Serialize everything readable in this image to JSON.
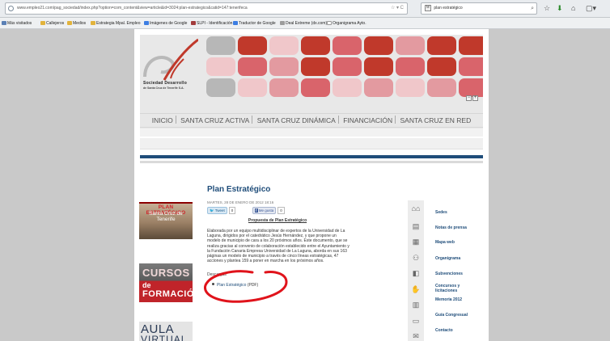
{
  "browser": {
    "url": "www.empleo21.com/pag_sociedad/index.php?option=com_content&view=article&id=3024:plan-estrategico&catid=147:tenerifeca",
    "search_query": "plan estratégico",
    "search_engine_glyph": "W",
    "bookmarks": [
      {
        "label": "Más visitados",
        "icon_color": "#5a7fb5"
      },
      {
        "label": "Callejeros",
        "icon_color": "#e2b33c"
      },
      {
        "label": "Medios",
        "icon_color": "#e2b33c"
      },
      {
        "label": "Estrategia Mpal. Empleo",
        "icon_color": "#e2b33c"
      },
      {
        "label": "Imágenes de Google",
        "icon_color": "#3c7de2"
      },
      {
        "label": "SLPI - Identificación",
        "icon_color": "#a23c3c"
      },
      {
        "label": "Traductor de Google",
        "icon_color": "#3c7de2"
      },
      {
        "label": "Deal Extreme (dx.com)",
        "icon_color": "#9c9c9c"
      },
      {
        "label": "Organigrama Ayto.",
        "icon_color": "#e2e2e2"
      }
    ]
  },
  "header": {
    "logo_line1": "Sociedad Desarrollo",
    "logo_line2": "de Santa Cruz de Tenerife S.A.",
    "square_colors": [
      "#c0392b",
      "#c0392b",
      "#c0392b",
      "#c0392b",
      "#c0392b",
      "#c0392b",
      "#c0392b",
      "#c0392b",
      "#c0392b",
      "#c0392b"
    ],
    "font_minus": "−",
    "font_plus": "+"
  },
  "nav": {
    "items": [
      "INICIO",
      "SANTA CRUZ ACTIVA",
      "SANTA CRUZ DINÁMICA",
      "FINANCIACIÓN",
      "SANTA CRUZ EN RED"
    ]
  },
  "banners": {
    "plan_title": "PLAN ESTRATÉGICO",
    "plan_sub1": "Santa Cruz de",
    "plan_sub2": "Tenerife",
    "cursos_line1": "CURSOS",
    "cursos_line2": "de",
    "cursos_line3": "FORMACIÓN",
    "aula_line1": "AULA",
    "aula_line2": "VIRTUAL"
  },
  "article": {
    "title": "Plan Estratégico",
    "date": "MARTES, 28 DE ENERO DE 2012 18:16",
    "tweet_label": "Tweet",
    "tweet_count": "0",
    "like_label": "Me gusta",
    "like_count": "0",
    "proposal_heading": "Propuesta de Plan Estratégico",
    "body": "Elaborada por un equipo multidisciplinar de expertos de la Universidad de La Laguna, dirigidos por el catedrático Jesús Hernández, y que propone un modelo de municipio de cara a los 20 próximos años. Este documento, que se realiza gracias al convenio de colaboración establecido entre el Ayuntamiento y la Fundación Canaria Empresa Universidad de La Laguna, aborda en sus 163 páginas un modelo de municipio a través de cinco líneas estratégicas, 47 acciones y plantea 159 a poner en marcha en los próximos años.",
    "downloads_label": "Descargas",
    "download_link": "Plan Estratégico",
    "download_suffix": "(PDF)"
  },
  "sidebar": {
    "links": [
      "Sedes",
      "Notas de prensa",
      "Mapa web",
      "Organigrama",
      "Subvenciones",
      "Concursos y licitaciones",
      "Memoria 2012",
      "Guía Congresual",
      "Contacto"
    ]
  },
  "colors": {
    "accent_blue": "#1f4d7a",
    "brand_red": "#c0392b",
    "annotation_red": "#e0131b"
  }
}
